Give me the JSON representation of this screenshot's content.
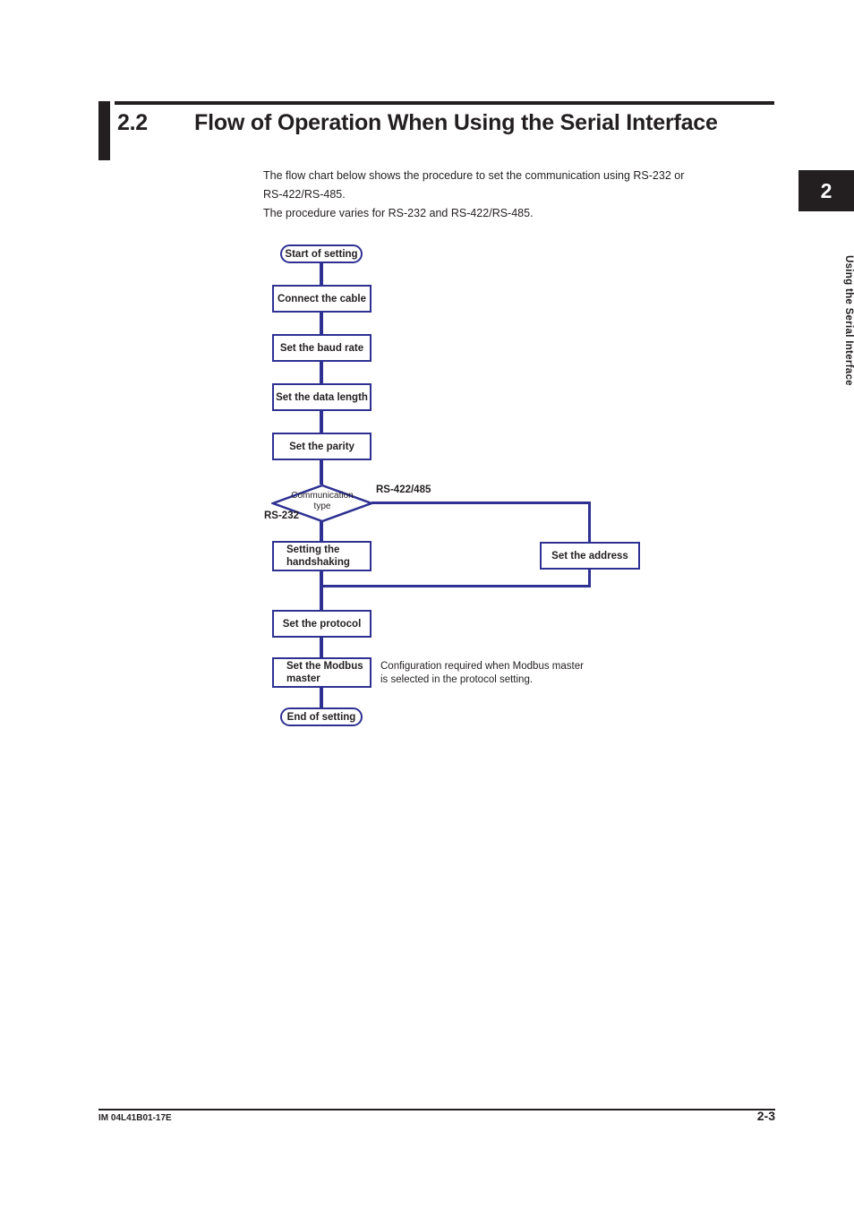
{
  "page": {
    "section_number": "2.2",
    "section_title": "Flow of Operation When Using the Serial Interface",
    "intro_line_1": "The flow chart below shows the procedure to set the communication using RS-232 or",
    "intro_line_2": "RS-422/RS-485.",
    "intro_line_3": "The procedure varies for RS-232 and RS-422/RS-485."
  },
  "chapter_tab": {
    "number": "2",
    "label": "Using the Serial Interface"
  },
  "flowchart": {
    "start_terminator": "Start of setting",
    "step_connect_cable": "Connect the cable",
    "step_baud_rate": "Set the baud rate",
    "step_data_length": "Set the data length",
    "step_parity": "Set the parity",
    "decision_line_1": "Communication",
    "decision_line_2": "type",
    "branch_label_right": "RS-422/485",
    "branch_label_left": "RS-232",
    "step_handshaking_line_1": "Setting the",
    "step_handshaking_line_2": "handshaking",
    "step_address": "Set the address",
    "step_protocol": "Set the protocol",
    "step_modbus_line_1": "Set the Modbus",
    "step_modbus_line_2": "master",
    "end_terminator": "End of setting",
    "note_line_1": "Configuration required when Modbus master",
    "note_line_2": "is selected in the protocol setting."
  },
  "footer": {
    "document_code": "IM 04L41B01-17E",
    "page_number": "2-3"
  },
  "colors": {
    "flowchart_stroke": "#2e3192",
    "text": "#231f20",
    "accent_black": "#231f20"
  }
}
